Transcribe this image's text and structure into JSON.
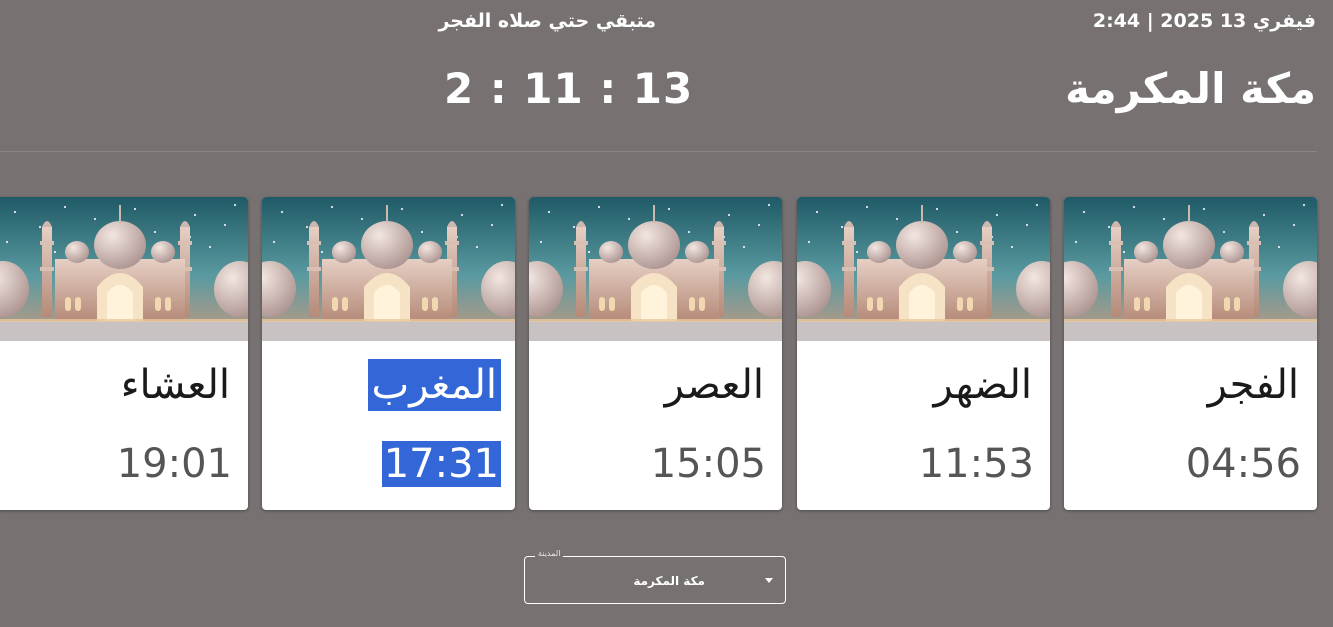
{
  "header": {
    "date_line": "فيفري 13 2025 | 2:44",
    "countdown_label": "متبقي حتي صلاه الفجر",
    "city_title": "مكة المكرمة",
    "countdown": "2 : 11 : 13"
  },
  "prayers": [
    {
      "name": "الفجر",
      "time": "04:56",
      "active": false
    },
    {
      "name": "الضهر",
      "time": "11:53",
      "active": false
    },
    {
      "name": "العصر",
      "time": "15:05",
      "active": false
    },
    {
      "name": "المغرب",
      "time": "17:31",
      "active": true
    },
    {
      "name": "العشاء",
      "time": "19:01",
      "active": false
    }
  ],
  "city_select": {
    "legend": "المدينة",
    "value": "مكة المكرمة"
  },
  "colors": {
    "background": "#777271",
    "highlight": "#3366d6",
    "card": "#ffffff"
  },
  "icons": {
    "dropdown": "chevron-down-icon",
    "card_image": "mosque-image"
  }
}
